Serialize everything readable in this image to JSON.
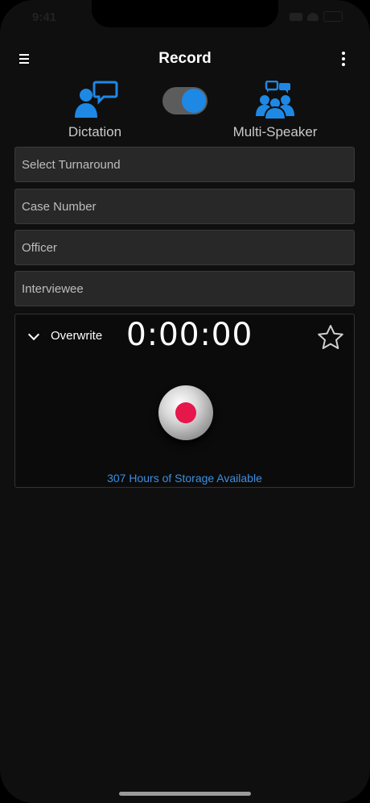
{
  "status_bar": {
    "time": "9:41"
  },
  "header": {
    "title": "Record"
  },
  "mode": {
    "dictation_label": "Dictation",
    "multi_speaker_label": "Multi-Speaker",
    "toggle_on": true,
    "accent_color": "#1e88e5"
  },
  "form": {
    "turnaround_placeholder": "Select Turnaround",
    "case_number_placeholder": "Case Number",
    "officer_placeholder": "Officer",
    "interviewee_placeholder": "Interviewee"
  },
  "recorder": {
    "overwrite_label": "Overwrite",
    "timer": "0:00:00",
    "storage_text": "307 Hours of Storage Available",
    "record_color": "#e6174b"
  }
}
